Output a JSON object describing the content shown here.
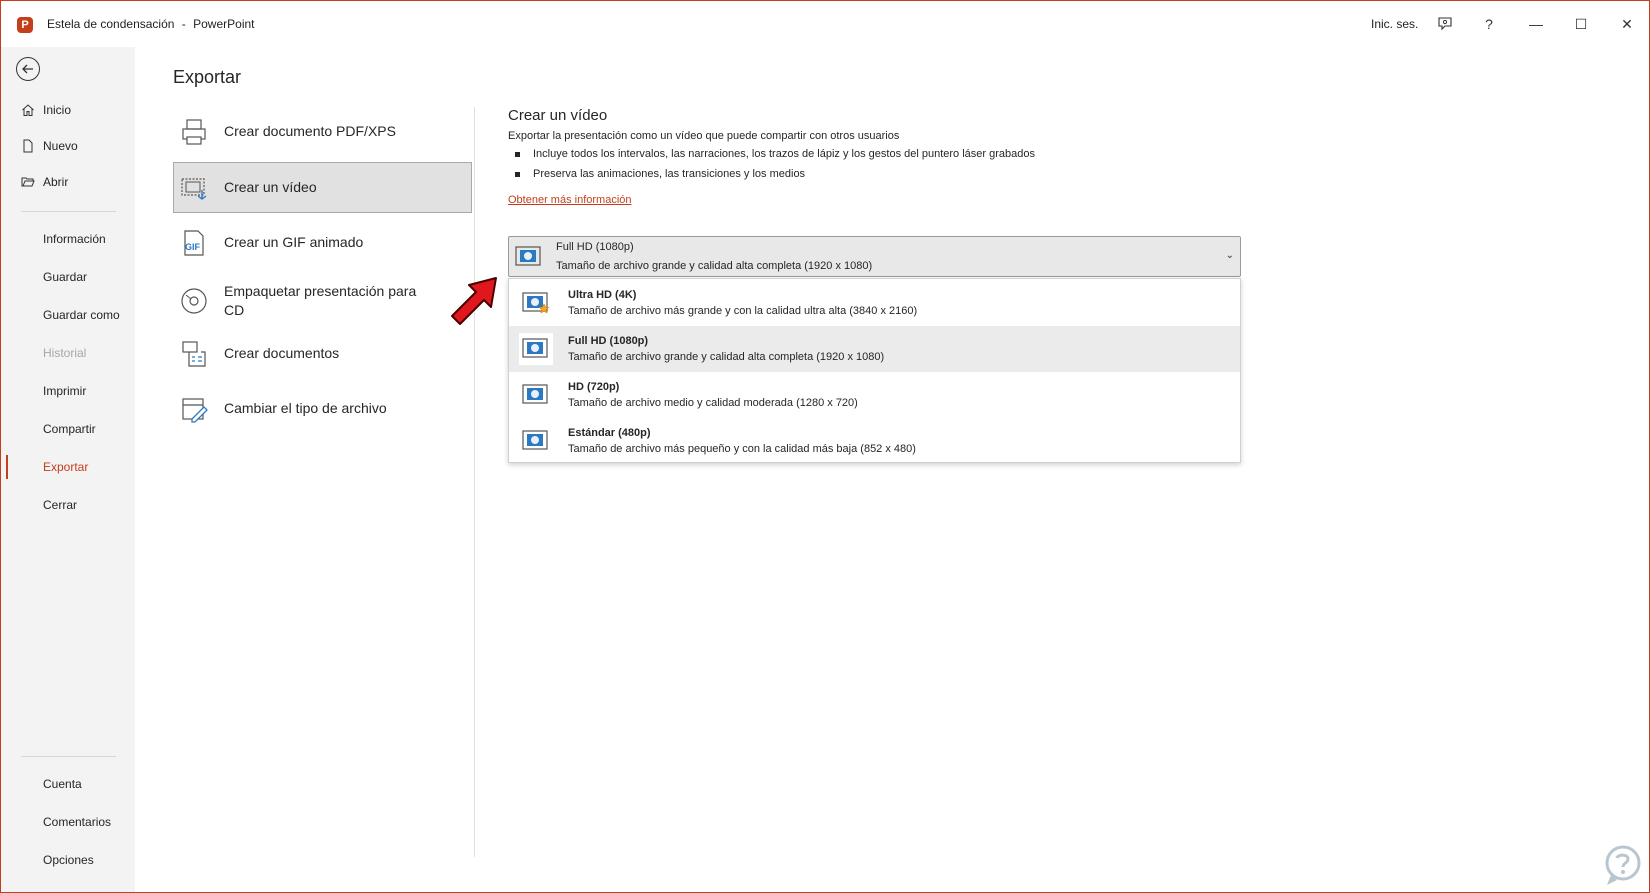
{
  "titlebar": {
    "doc_title": "Estela de condensación",
    "separator": "-",
    "app_name": "PowerPoint",
    "logo_letter": "P",
    "signin": "Inic. ses.",
    "help": "?",
    "minimize": "—",
    "maximize": "☐",
    "close": "✕"
  },
  "nav": {
    "top_items": [
      {
        "label": "Inicio",
        "icon": "home-icon"
      },
      {
        "label": "Nuevo",
        "icon": "new-document-icon"
      },
      {
        "label": "Abrir",
        "icon": "open-folder-icon"
      }
    ],
    "mid_items": [
      {
        "label": "Información"
      },
      {
        "label": "Guardar"
      },
      {
        "label": "Guardar como"
      },
      {
        "label": "Historial",
        "disabled": true
      },
      {
        "label": "Imprimir"
      },
      {
        "label": "Compartir"
      },
      {
        "label": "Exportar",
        "active": true
      },
      {
        "label": "Cerrar"
      }
    ],
    "bottom_items": [
      {
        "label": "Cuenta"
      },
      {
        "label": "Comentarios"
      },
      {
        "label": "Opciones"
      }
    ]
  },
  "main": {
    "title": "Exportar",
    "options": [
      {
        "label": "Crear documento PDF/XPS",
        "icon": "pdf-xps-icon"
      },
      {
        "label": "Crear un vídeo",
        "icon": "video-icon",
        "selected": true
      },
      {
        "label": "Crear un GIF animado",
        "icon": "gif-icon",
        "gif_text": "GIF"
      },
      {
        "label": "Empaquetar presentación para CD",
        "icon": "cd-icon"
      },
      {
        "label": "Crear documentos",
        "icon": "handouts-icon"
      },
      {
        "label": "Cambiar el tipo de archivo",
        "icon": "change-file-type-icon"
      }
    ]
  },
  "video": {
    "title": "Crear un vídeo",
    "description": "Exportar la presentación como un vídeo que puede compartir con otros usuarios",
    "bullets": [
      "Incluye todos los intervalos, las narraciones, los trazos de lápiz y los gestos del puntero láser grabados",
      "Preserva las animaciones, las transiciones y los medios"
    ],
    "more_link": "Obtener más información",
    "quality": {
      "selected_title": "Full HD (1080p)",
      "selected_sub": "Tamaño de archivo grande y calidad alta completa (1920 x 1080)",
      "chevron": "⌄",
      "options": [
        {
          "title": "Ultra HD (4K)",
          "sub": "Tamaño de archivo más grande y con la calidad ultra alta (3840 x 2160)",
          "icon": "ultra-hd-icon"
        },
        {
          "title": "Full HD (1080p)",
          "sub": "Tamaño de archivo grande y calidad alta completa (1920 x 1080)",
          "icon": "full-hd-icon",
          "highlighted": true
        },
        {
          "title": "HD (720p)",
          "sub": "Tamaño de archivo medio y calidad moderada (1280 x 720)",
          "icon": "hd-icon"
        },
        {
          "title": "Estándar (480p)",
          "sub": "Tamaño de archivo más pequeño y con la calidad más baja (852 x 480)",
          "icon": "standard-icon"
        }
      ]
    }
  },
  "colors": {
    "accent": "#c43e1c",
    "arrow": "#e0181d"
  }
}
